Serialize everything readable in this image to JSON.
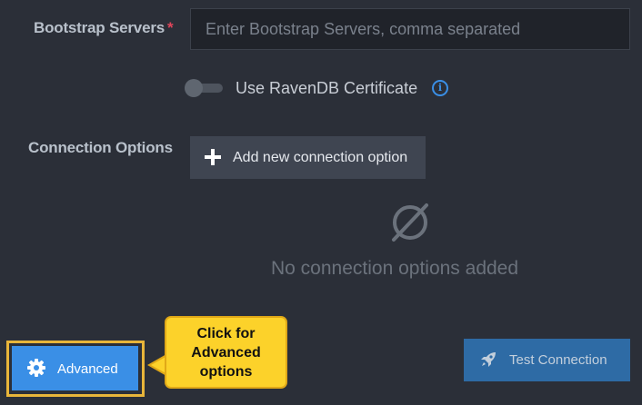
{
  "bootstrap_servers": {
    "label": "Bootstrap Servers",
    "required_marker": "*",
    "value": "",
    "placeholder": "Enter Bootstrap Servers, comma separated"
  },
  "certificate": {
    "label": "Use RavenDB Certificate",
    "enabled": false,
    "info_icon": "info-circle-icon",
    "info_glyph": "i"
  },
  "connection_options": {
    "label": "Connection Options",
    "add_button_label": "Add new connection option",
    "add_icon": "plus-icon",
    "empty_icon": "empty-set-icon",
    "empty_text": "No connection options added"
  },
  "footer": {
    "advanced_label": "Advanced",
    "advanced_icon": "gear-icon",
    "test_label": "Test Connection",
    "test_icon": "rocket-icon"
  },
  "callout": {
    "lines": [
      "Click for",
      "Advanced",
      "options"
    ]
  },
  "colors": {
    "background": "#2b2f38",
    "accent": "#3a8fe6",
    "required": "#e0455a",
    "callout": "#fcd22a",
    "highlight": "#e8b53a"
  }
}
